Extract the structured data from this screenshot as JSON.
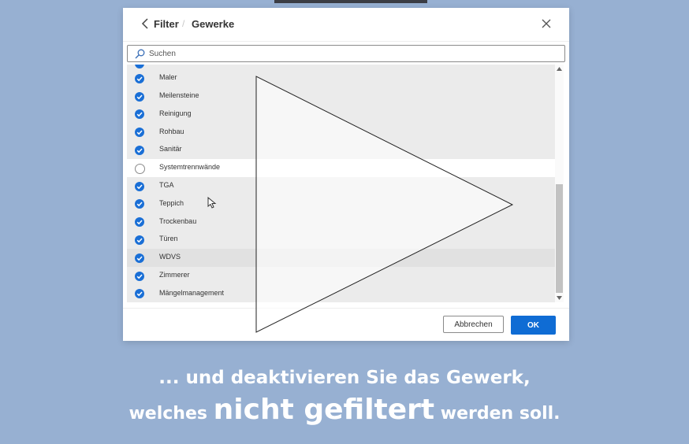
{
  "header": {
    "breadcrumb_parent": "Filter",
    "breadcrumb_separator": "/",
    "breadcrumb_current": "Gewerke"
  },
  "search": {
    "placeholder": "Suchen",
    "value": ""
  },
  "list": {
    "items": [
      {
        "label": "Maler",
        "checked": true
      },
      {
        "label": "Meilensteine",
        "checked": true
      },
      {
        "label": "Reinigung",
        "checked": true
      },
      {
        "label": "Rohbau",
        "checked": true
      },
      {
        "label": "Sanitär",
        "checked": true
      },
      {
        "label": "Systemtrennwände",
        "checked": false
      },
      {
        "label": "TGA",
        "checked": true
      },
      {
        "label": "Teppich",
        "checked": true
      },
      {
        "label": "Trockenbau",
        "checked": true
      },
      {
        "label": "Türen",
        "checked": true
      },
      {
        "label": "WDVS",
        "checked": true
      },
      {
        "label": "Zimmerer",
        "checked": true
      },
      {
        "label": "Mängelmanagement",
        "checked": true
      }
    ]
  },
  "footer": {
    "cancel_label": "Abbrechen",
    "ok_label": "OK"
  },
  "caption": {
    "line1": "... und deaktivieren Sie das Gewerk,",
    "line2_pre": "welches ",
    "line2_emphasis": "nicht gefiltert",
    "line2_post": " werden soll."
  },
  "colors": {
    "page_background": "#97b0d2",
    "accent": "#0f6cd4",
    "checkbox_checked": "#1a6fd6",
    "list_background": "#ebebeb",
    "unchecked_row_background": "#ffffff"
  },
  "icons": {
    "back": "chevron-left-icon",
    "close": "close-icon",
    "search": "search-icon",
    "check": "checkmark-circle-icon",
    "play": "play-icon",
    "cursor": "mouse-pointer-icon"
  }
}
